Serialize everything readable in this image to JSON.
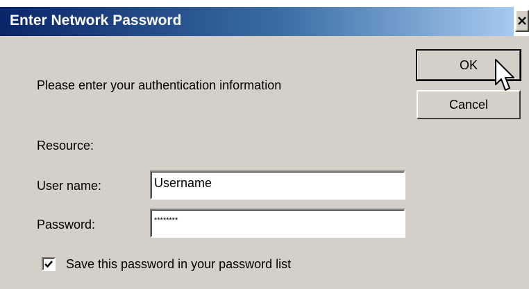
{
  "window": {
    "title": "Enter Network Password",
    "close_glyph": "✕"
  },
  "dialog": {
    "prompt": "Please enter your authentication information",
    "resource_label": "Resource:",
    "username_label": "User name:",
    "username_value": "Username",
    "password_label": "Password:",
    "password_value": "********",
    "save_checkbox_label": "Save this password in your password list",
    "save_checkbox_checked": true
  },
  "buttons": {
    "ok_label": "OK",
    "cancel_label": "Cancel"
  },
  "icons": {
    "close": "close-icon",
    "checkmark": "checkmark-icon",
    "cursor": "mouse-pointer-icon"
  },
  "colors": {
    "title_start": "#0a246a",
    "title_end": "#a6caf0",
    "dialog_bg": "#d4d0c8"
  }
}
